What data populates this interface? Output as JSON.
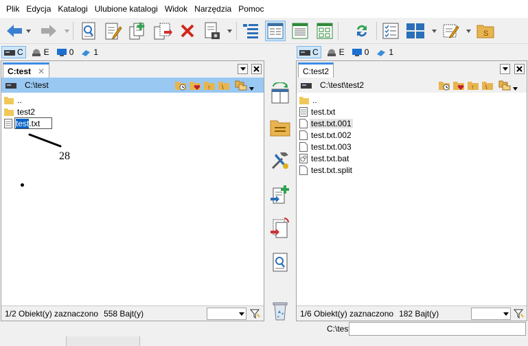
{
  "menu": [
    "Plik",
    "Edycja",
    "Katalogi",
    "Ulubione katalogi",
    "Widok",
    "Narzędzia",
    "Pomoc"
  ],
  "toolbar_icons": [
    "back-arrow-icon",
    "forward-arrow-icon",
    "search-files-icon",
    "edit-file-icon",
    "new-file-icon",
    "copy-files-icon",
    "delete-icon",
    "properties-icon",
    "tree-view-icon",
    "brief-view-icon",
    "detailed-view-icon",
    "thumbnail-view-icon",
    "sync-dirs-icon",
    "checklist-icon",
    "layout-icon",
    "edit-settings-icon",
    "smb-icon"
  ],
  "left": {
    "drives": [
      {
        "label": "C",
        "icon": "hard-drive-icon",
        "selected": true
      },
      {
        "label": "E",
        "icon": "disk-icon"
      },
      {
        "label": "0",
        "icon": "monitor-icon"
      },
      {
        "label": "1",
        "icon": "network-icon"
      }
    ],
    "tab": "C:test",
    "path": "C:\\test",
    "rows": [
      {
        "name": "..",
        "type": "folder"
      },
      {
        "name": "test2",
        "type": "folder"
      },
      {
        "name": "test.txt",
        "type": "file",
        "rename_selected": "test",
        "rename_rest": ".txt"
      }
    ],
    "status_selected": "1/2 Obiekt(y) zaznaczono",
    "status_size": "558 Bajt(y)"
  },
  "right": {
    "drives": [
      {
        "label": "C",
        "icon": "hard-drive-icon",
        "selected": true
      },
      {
        "label": "E",
        "icon": "disk-icon"
      },
      {
        "label": "0",
        "icon": "monitor-icon"
      },
      {
        "label": "1",
        "icon": "network-icon"
      }
    ],
    "tab": "C:test2",
    "path": "C:\\test\\test2",
    "rows": [
      {
        "name": "..",
        "type": "folder"
      },
      {
        "name": "test.txt",
        "type": "file"
      },
      {
        "name": "test.txt.001",
        "type": "file",
        "highlight": true
      },
      {
        "name": "test.txt.002",
        "type": "file"
      },
      {
        "name": "test.txt.003",
        "type": "file"
      },
      {
        "name": "test.txt.bat",
        "type": "bat"
      },
      {
        "name": "test.txt.split",
        "type": "file"
      }
    ],
    "status_selected": "1/6 Obiekt(y) zaznaczono",
    "status_size": "182 Bajt(y)"
  },
  "tab_close": "✕",
  "cmd_label": "C:\\test\\",
  "annotation": "28",
  "colors": {
    "accent": "#3c8ce6",
    "pathbar": "#99c8f2",
    "selection": "#0a64c8"
  }
}
